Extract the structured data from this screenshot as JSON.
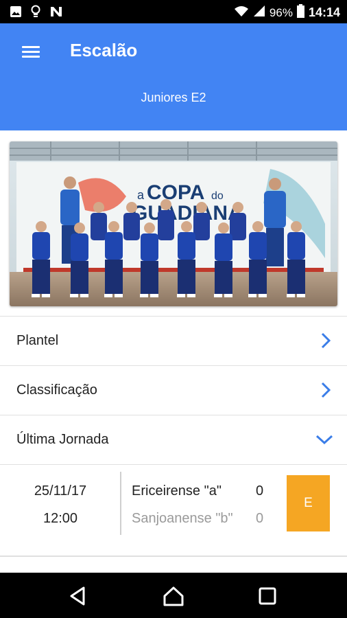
{
  "status_bar": {
    "battery": "96%",
    "time": "14:14",
    "left_icons": [
      "image-icon",
      "lightbulb-icon",
      "n-icon"
    ],
    "right_icons": [
      "wifi-icon",
      "signal-icon",
      "battery-icon"
    ]
  },
  "app_bar": {
    "title": "Escalão",
    "subtitle": "Juniores E2",
    "color": "#4284f3"
  },
  "photo": {
    "banner_text_1": "a",
    "banner_text_2": "COPA",
    "banner_text_3": "do",
    "banner_text_4": "GUADIANA"
  },
  "menu": {
    "plantel": "Plantel",
    "classificacao": "Classificação",
    "ultima_jornada": "Última Jornada"
  },
  "last_match": {
    "date": "25/11/17",
    "time": "12:00",
    "home_team": "Ericeirense \"a\"",
    "home_score": "0",
    "away_team": "Sanjoanense \"b\"",
    "away_score": "0",
    "result": "E",
    "result_color": "#f5a623"
  },
  "colors": {
    "accent": "#4284f3",
    "chevron": "#3a7de8"
  }
}
